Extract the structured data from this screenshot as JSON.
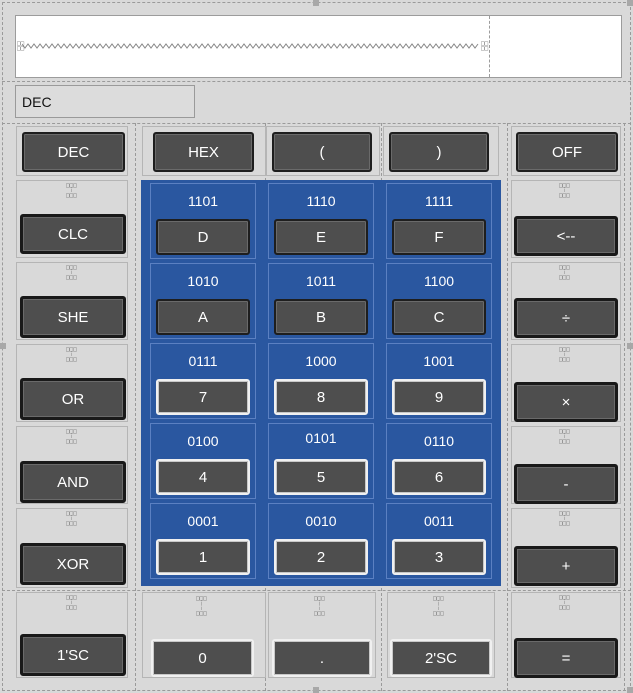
{
  "display": {
    "value": "",
    "mode": "DEC"
  },
  "top_row": {
    "dec": "DEC",
    "hex": "HEX",
    "lparen": "(",
    "rparen": ")",
    "off": "OFF"
  },
  "left_col": {
    "clc": "CLC",
    "she": "SHE",
    "or": "OR",
    "and": "AND",
    "xor": "XOR",
    "ones_comp": "1'SC"
  },
  "right_col": {
    "back": "<--",
    "div": "÷",
    "mul": "×",
    "sub": "-",
    "add": "+",
    "eq": "="
  },
  "grid": [
    [
      {
        "bin": "1101",
        "key": "D"
      },
      {
        "bin": "1110",
        "key": "E"
      },
      {
        "bin": "1111",
        "key": "F"
      }
    ],
    [
      {
        "bin": "1010",
        "key": "A"
      },
      {
        "bin": "1011",
        "key": "B"
      },
      {
        "bin": "1100",
        "key": "C"
      }
    ],
    [
      {
        "bin": "0111",
        "key": "7"
      },
      {
        "bin": "1000",
        "key": "8"
      },
      {
        "bin": "1001",
        "key": "9"
      }
    ],
    [
      {
        "bin": "0100",
        "key": "4"
      },
      {
        "bin": "0101",
        "key": "5"
      },
      {
        "bin": "0110",
        "key": "6"
      }
    ],
    [
      {
        "bin": "0001",
        "key": "1"
      },
      {
        "bin": "0010",
        "key": "2"
      },
      {
        "bin": "0011",
        "key": "3"
      }
    ]
  ],
  "bottom_row": {
    "zero": "0",
    "dot": ".",
    "twos_comp": "2'SC"
  }
}
